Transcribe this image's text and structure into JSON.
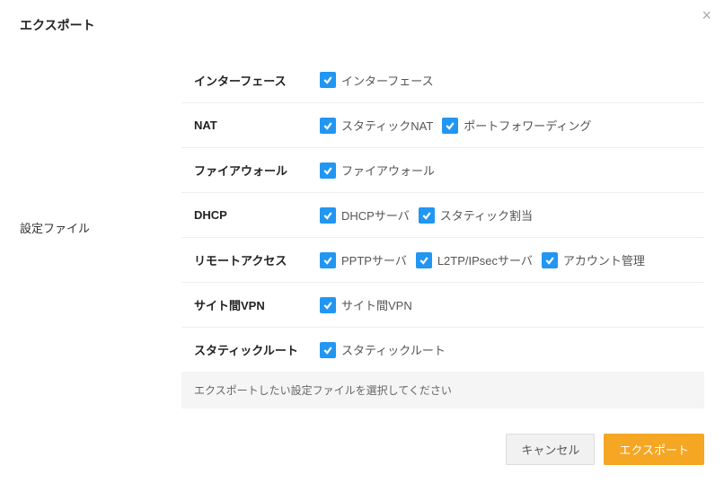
{
  "dialog": {
    "title": "エクスポート",
    "side_label": "設定ファイル",
    "hint": "エクスポートしたい設定ファイルを選択してください",
    "cancel": "キャンセル",
    "submit": "エクスポート"
  },
  "rows": {
    "interface": {
      "label": "インターフェース",
      "opt1": "インターフェース"
    },
    "nat": {
      "label": "NAT",
      "opt1": "スタティックNAT",
      "opt2": "ポートフォワーディング"
    },
    "firewall": {
      "label": "ファイアウォール",
      "opt1": "ファイアウォール"
    },
    "dhcp": {
      "label": "DHCP",
      "opt1": "DHCPサーバ",
      "opt2": "スタティック割当"
    },
    "remote": {
      "label": "リモートアクセス",
      "opt1": "PPTPサーバ",
      "opt2": "L2TP/IPsecサーバ",
      "opt3": "アカウント管理"
    },
    "s2s": {
      "label": "サイト間VPN",
      "opt1": "サイト間VPN"
    },
    "route": {
      "label": "スタティックルート",
      "opt1": "スタティックルート"
    }
  }
}
